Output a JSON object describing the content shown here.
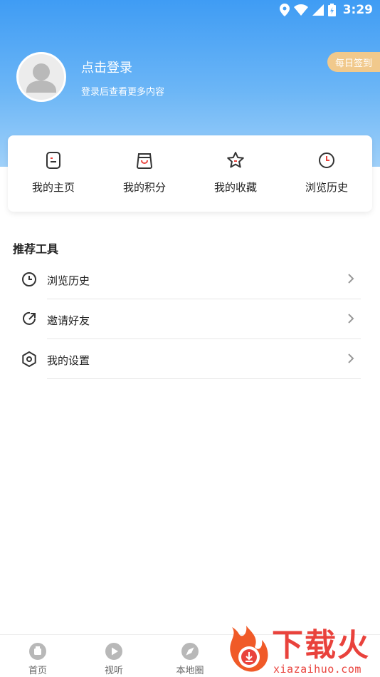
{
  "status_bar": {
    "time": "3:29"
  },
  "profile": {
    "login_title": "点击登录",
    "login_subtitle": "登录后查看更多内容",
    "checkin_label": "每日签到"
  },
  "quick_actions": [
    {
      "label": "我的主页",
      "icon": "note-icon"
    },
    {
      "label": "我的积分",
      "icon": "shopping-bag-icon"
    },
    {
      "label": "我的收藏",
      "icon": "star-icon"
    },
    {
      "label": "浏览历史",
      "icon": "clock-icon"
    }
  ],
  "tools": {
    "title": "推荐工具",
    "items": [
      {
        "label": "浏览历史",
        "icon": "clock-icon"
      },
      {
        "label": "邀请好友",
        "icon": "share-icon"
      },
      {
        "label": "我的设置",
        "icon": "settings-icon"
      }
    ]
  },
  "bottom_nav": [
    {
      "label": "首页",
      "icon": "home-icon"
    },
    {
      "label": "视听",
      "icon": "play-icon"
    },
    {
      "label": "本地圈",
      "icon": "compass-icon"
    }
  ],
  "watermark": {
    "brand": "下载火",
    "url": "xiazaihuo.com"
  },
  "colors": {
    "header_top": "#3f9cf4",
    "header_bottom": "#9fd0f9",
    "checkin_bg": "#f1c98c",
    "accent_red": "#e9423c"
  }
}
